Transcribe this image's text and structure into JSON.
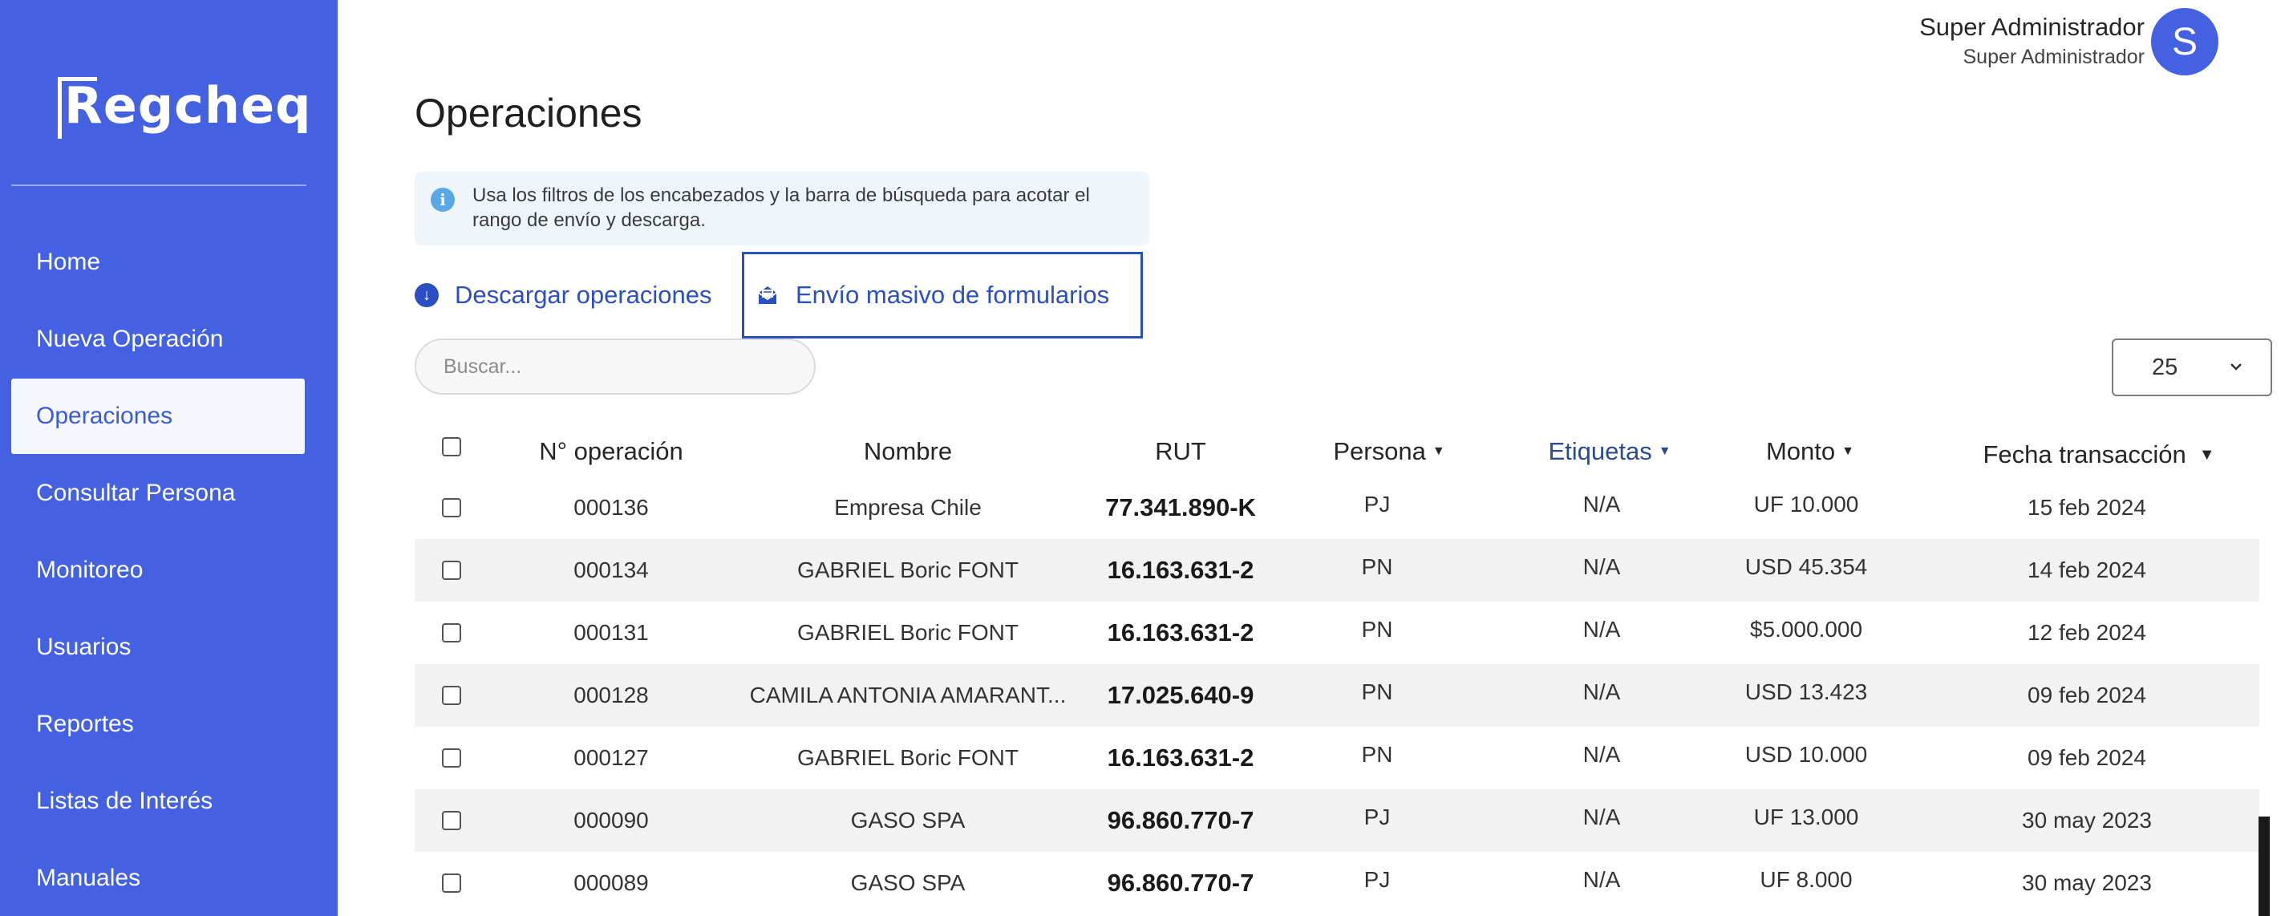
{
  "app": {
    "logo_text": "Regcheq"
  },
  "sidebar": {
    "items": [
      {
        "label": "Home"
      },
      {
        "label": "Nueva Operación"
      },
      {
        "label": "Operaciones",
        "active": true
      },
      {
        "label": "Consultar Persona"
      },
      {
        "label": "Monitoreo"
      },
      {
        "label": "Usuarios"
      },
      {
        "label": "Reportes"
      },
      {
        "label": "Listas de Interés"
      },
      {
        "label": "Manuales"
      }
    ]
  },
  "header": {
    "user_name": "Super Administrador",
    "user_role": "Super Administrador",
    "avatar_initial": "S"
  },
  "page": {
    "title": "Operaciones",
    "info_text": "Usa los filtros de los encabezados y la barra de búsqueda para acotar el rango de envío y descarga.",
    "download_label": "Descargar operaciones",
    "bulk_send_label": "Envío masivo de formularios",
    "search_placeholder": "Buscar...",
    "page_size": "25"
  },
  "table": {
    "columns": {
      "num": "N° operación",
      "nombre": "Nombre",
      "rut": "RUT",
      "persona": "Persona",
      "etiquetas": "Etiquetas",
      "monto": "Monto",
      "fecha": "Fecha transacción"
    },
    "rows": [
      {
        "num": "000136",
        "nombre": "Empresa Chile",
        "rut": "77.341.890-K",
        "persona": "PJ",
        "etiquetas": "N/A",
        "monto": "UF 10.000",
        "fecha": "15 feb 2024"
      },
      {
        "num": "000134",
        "nombre": "GABRIEL Boric FONT",
        "rut": "16.163.631-2",
        "persona": "PN",
        "etiquetas": "N/A",
        "monto": "USD 45.354",
        "fecha": "14 feb 2024"
      },
      {
        "num": "000131",
        "nombre": "GABRIEL Boric FONT",
        "rut": "16.163.631-2",
        "persona": "PN",
        "etiquetas": "N/A",
        "monto": "$5.000.000",
        "fecha": "12 feb 2024"
      },
      {
        "num": "000128",
        "nombre": "CAMILA ANTONIA AMARANT...",
        "rut": "17.025.640-9",
        "persona": "PN",
        "etiquetas": "N/A",
        "monto": "USD 13.423",
        "fecha": "09 feb 2024"
      },
      {
        "num": "000127",
        "nombre": "GABRIEL Boric FONT",
        "rut": "16.163.631-2",
        "persona": "PN",
        "etiquetas": "N/A",
        "monto": "USD 10.000",
        "fecha": "09 feb 2024"
      },
      {
        "num": "000090",
        "nombre": "GASO SPA",
        "rut": "96.860.770-7",
        "persona": "PJ",
        "etiquetas": "N/A",
        "monto": "UF 13.000",
        "fecha": "30 may 2023"
      },
      {
        "num": "000089",
        "nombre": "GASO SPA",
        "rut": "96.860.770-7",
        "persona": "PJ",
        "etiquetas": "N/A",
        "monto": "UF 8.000",
        "fecha": "30 may 2023"
      }
    ]
  }
}
